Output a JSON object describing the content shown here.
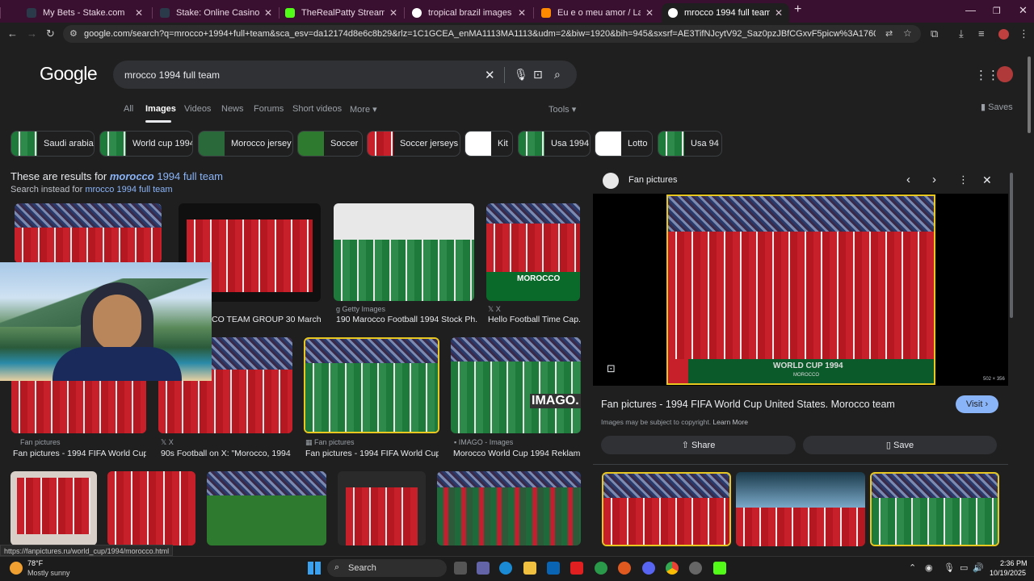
{
  "browser": {
    "tabs": [
      {
        "title": "My Bets - Stake.com",
        "color": "#2a3a4a"
      },
      {
        "title": "Stake: Online Casino & Sports B",
        "color": "#2a3a4a"
      },
      {
        "title": "TheRealPatty Stream - Watch Li",
        "color": "#53fc18"
      },
      {
        "title": "tropical brazil images jpg file - ",
        "color": "#4285f4"
      },
      {
        "title": "Eu e o meu amor / Lamento do",
        "color": "#ff8a00"
      },
      {
        "title": "mrocco 1994 full team - Googl",
        "color": "#4285f4",
        "active": true
      }
    ],
    "url": "google.com/search?q=mrocco+1994+full+team&sca_esv=da12174d8e6c8b29&rlz=1C1GCEA_enMA1113MA1113&udm=2&biw=1920&bih=945&sxsrf=AE3TifNJcytV92_Saz0pzJBfCGxvF5picw%3A1760880918024&ei=Fun0aN-dAdyYkdUP...",
    "status_url": "https://fanpictures.ru/world_cup/1994/morocco.html"
  },
  "google": {
    "logo": "Google",
    "query": "mrocco 1994 full team",
    "nav": [
      "All",
      "Images",
      "Videos",
      "News",
      "Forums",
      "Short videos",
      "More",
      "Tools"
    ],
    "saves": "Saves",
    "chips": [
      "Saudi arabia",
      "World cup 1994",
      "Morocco jersey",
      "Soccer",
      "Soccer jerseys",
      "Kit",
      "Usa 1994",
      "Lotto",
      "Usa 94"
    ],
    "results_note": {
      "prefix": "These are results for ",
      "bold": "morocco",
      "rest": " 1994 full team"
    },
    "search_instead": {
      "prefix": "Search instead for ",
      "link": "mrocco 1994 full team"
    }
  },
  "results": [
    {
      "source": "Getty Images",
      "caption": "190 Marocco Football 1994 Stock Ph..."
    },
    {
      "source": "X",
      "caption": "Hello Football Time Cap..."
    },
    {
      "source": "",
      "caption": "CO TEAM GROUP 30 March ..."
    },
    {
      "source": "Fan pictures",
      "caption": "Fan pictures - 1994 FIFA World Cup..."
    },
    {
      "source": "X",
      "caption": "90s Football on X: \"Morocco, 1994 ..."
    },
    {
      "source": "Fan pictures",
      "caption": "Fan pictures - 1994 FIFA World Cup..."
    },
    {
      "source": "IMAGO - Images",
      "caption": "Morocco World Cup 1994 Reklam..."
    }
  ],
  "thumb_texts": {
    "morocco": "MOROCCO",
    "imago": "IMAGO."
  },
  "panel": {
    "source": "Fan pictures",
    "banner": "WORLD CUP 1994",
    "banner_sub": "MOROCCO",
    "dims": "502 × 356",
    "title": "Fan pictures - 1994 FIFA World Cup United States. Morocco team",
    "visit": "Visit",
    "copyright": "Images may be subject to copyright.",
    "learn_more": "Learn More",
    "share": "Share",
    "save": "Save"
  },
  "taskbar": {
    "temp": "78°F",
    "weather": "Mostly sunny",
    "search": "Search",
    "time": "2:36 PM",
    "date": "10/19/2025"
  },
  "colors": {
    "accent": "#8ab4f8",
    "tabstrip": "#3a1030",
    "bg": "#1f1f1f"
  }
}
